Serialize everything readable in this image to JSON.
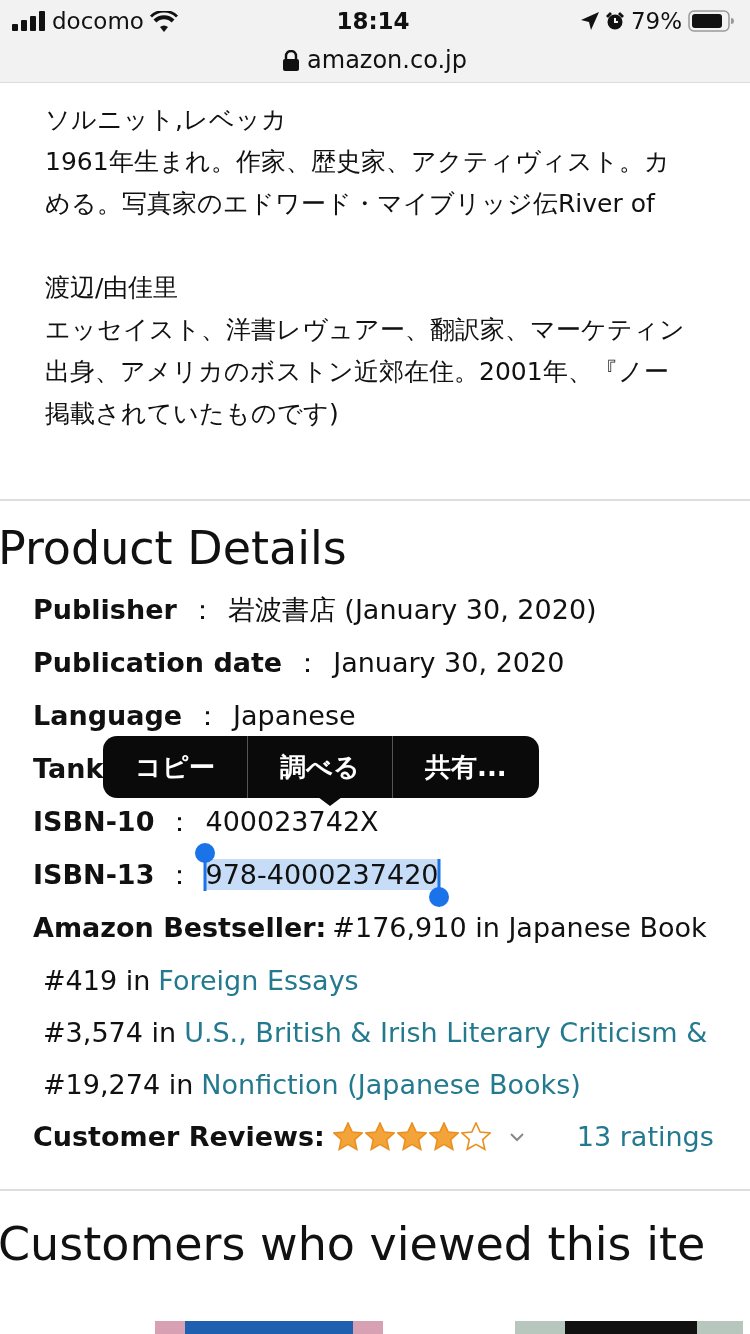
{
  "status_bar": {
    "carrier": "docomo",
    "time": "18:14",
    "battery": "79%"
  },
  "address_bar": {
    "url": "amazon.co.jp"
  },
  "authors": [
    {
      "name": "ソルニット,レベッカ",
      "lines": [
        "1961年生まれ。作家、歴史家、アクティヴィスト。カ",
        "める。写真家のエドワード・マイブリッジ伝River of"
      ]
    },
    {
      "name": "渡辺/由佳里",
      "lines": [
        "エッセイスト、洋書レヴュアー、翻訳家、マーケティン",
        "出身、アメリカのボストン近郊在住。2001年、『ノー",
        "掲載されていたものです)"
      ]
    }
  ],
  "product_details": {
    "title": "Product Details",
    "rows": [
      {
        "label": "Publisher",
        "separator": "：",
        "value": "岩波書店 (January 30, 2020)",
        "selected": false
      },
      {
        "label": "Publication date",
        "separator": "：",
        "value": "January 30, 2020",
        "selected": false
      },
      {
        "label": "Language",
        "separator": "：",
        "value": "Japanese",
        "selected": false
      },
      {
        "label": "Tank",
        "selected": false
      },
      {
        "label": "ISBN-10",
        "separator": "：",
        "value": "400023742X",
        "selected": false
      },
      {
        "label": "ISBN-13",
        "separator": "：",
        "value": "978-4000237420",
        "selected": true
      }
    ],
    "bestseller": {
      "label": "Amazon Bestseller:",
      "text": "#176,910 in Japanese Book",
      "ranks": [
        {
          "rank": "#419 in",
          "category": "Foreign Essays"
        },
        {
          "rank": "#3,574 in",
          "category": "U.S., British & Irish Literary Criticism &"
        },
        {
          "rank": "#19,274 in",
          "category": "Nonfiction (Japanese Books)"
        }
      ]
    },
    "reviews": {
      "label": "Customer Reviews:",
      "stars": 4,
      "ratings": "13 ratings"
    }
  },
  "context_menu": [
    "コピー",
    "調べる",
    "共有..."
  ],
  "related": {
    "title": "Customers who viewed this ite"
  }
}
